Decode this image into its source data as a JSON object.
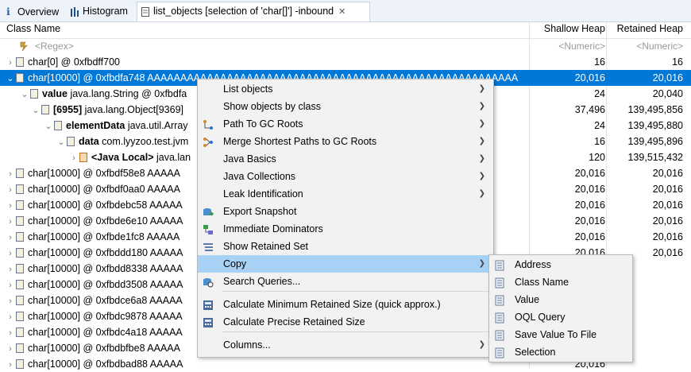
{
  "tabs": [
    {
      "label": "Overview"
    },
    {
      "label": "Histogram"
    },
    {
      "label": "list_objects  [selection of 'char[]'] -inbound"
    }
  ],
  "columns": {
    "class_name": "Class Name",
    "shallow_heap": "Shallow Heap",
    "retained_heap": "Retained Heap"
  },
  "filters": {
    "class_name": "<Regex>",
    "shallow_heap": "<Numeric>",
    "retained_heap": "<Numeric>"
  },
  "rows": [
    {
      "bold": "",
      "text": "char[0] @ 0xfbdff700",
      "extra": "",
      "shallow": "16",
      "retained": "16"
    },
    {
      "bold": "",
      "text": "char[10000] @ 0xfbdfa748  AAAAAAAAAAAAAAAAAAAAAAAAAAAAAAAAAAAAAAAAAAAAAAAAAAAAAAAA",
      "extra": "",
      "shallow": "20,016",
      "retained": "20,016"
    },
    {
      "bold": "value",
      "text": " java.lang.String @ 0xfbdfa",
      "extra": "AAAAA",
      "shallow": "24",
      "retained": "20,040"
    },
    {
      "bold": "[6955]",
      "text": " java.lang.Object[9369]",
      "extra": "",
      "shallow": "37,496",
      "retained": "139,495,856"
    },
    {
      "bold": "elementData",
      "text": " java.util.Array",
      "extra": "",
      "shallow": "24",
      "retained": "139,495,880"
    },
    {
      "bold": "data",
      "text": " com.lyyzoo.test.jvm",
      "extra": "",
      "shallow": "16",
      "retained": "139,495,896"
    },
    {
      "bold": "<Java Local>",
      "text": " java.lan",
      "extra": "",
      "shallow": "120",
      "retained": "139,515,432"
    },
    {
      "bold": "",
      "text": "char[10000] @ 0xfbdf58e8  AAAAA",
      "extra": "AAAAA",
      "shallow": "20,016",
      "retained": "20,016"
    },
    {
      "bold": "",
      "text": "char[10000] @ 0xfbdf0aa0  AAAAA",
      "extra": "AAAAA",
      "shallow": "20,016",
      "retained": "20,016"
    },
    {
      "bold": "",
      "text": "char[10000] @ 0xfbdebc58  AAAAA",
      "extra": "AAAAA",
      "shallow": "20,016",
      "retained": "20,016"
    },
    {
      "bold": "",
      "text": "char[10000] @ 0xfbde6e10  AAAAA",
      "extra": "AAAAA",
      "shallow": "20,016",
      "retained": "20,016"
    },
    {
      "bold": "",
      "text": "char[10000] @ 0xfbde1fc8  AAAAA",
      "extra": "AAAAA",
      "shallow": "20,016",
      "retained": "20,016"
    },
    {
      "bold": "",
      "text": "char[10000] @ 0xfbddd180  AAAAA",
      "extra": "AAAAA",
      "shallow": "20,016",
      "retained": "20,016"
    },
    {
      "bold": "",
      "text": "char[10000] @ 0xfbdd8338  AAAAA",
      "extra": "",
      "shallow": "",
      "retained": ""
    },
    {
      "bold": "",
      "text": "char[10000] @ 0xfbdd3508  AAAAA",
      "extra": "",
      "shallow": "",
      "retained": ""
    },
    {
      "bold": "",
      "text": "char[10000] @ 0xfbdce6a8  AAAAA",
      "extra": "",
      "shallow": "",
      "retained": ""
    },
    {
      "bold": "",
      "text": "char[10000] @ 0xfbdc9878  AAAAA",
      "extra": "",
      "shallow": "",
      "retained": ""
    },
    {
      "bold": "",
      "text": "char[10000] @ 0xfbdc4a18  AAAAA",
      "extra": "",
      "shallow": "",
      "retained": ""
    },
    {
      "bold": "",
      "text": "char[10000] @ 0xfbdbfbe8  AAAAA",
      "extra": "",
      "shallow": "",
      "retained": ""
    },
    {
      "bold": "",
      "text": "char[10000] @ 0xfbdbad88  AAAAA",
      "extra": "",
      "shallow": "20,016",
      "retained": ""
    }
  ],
  "context_menu": {
    "items": [
      {
        "label": "List objects",
        "submenu": true,
        "icon": ""
      },
      {
        "label": "Show objects by class",
        "submenu": true,
        "icon": ""
      },
      {
        "label": "Path To GC Roots",
        "submenu": true,
        "icon": "path-icon"
      },
      {
        "label": "Merge Shortest Paths to GC Roots",
        "submenu": true,
        "icon": "merge-icon"
      },
      {
        "label": "Java Basics",
        "submenu": true,
        "icon": ""
      },
      {
        "label": "Java Collections",
        "submenu": true,
        "icon": ""
      },
      {
        "label": "Leak Identification",
        "submenu": true,
        "icon": ""
      },
      {
        "label": "Export Snapshot",
        "submenu": false,
        "icon": "export-icon"
      },
      {
        "label": "Immediate Dominators",
        "submenu": false,
        "icon": "dominators-icon"
      },
      {
        "label": "Show Retained Set",
        "submenu": false,
        "icon": "retained-set-icon"
      },
      {
        "label": "Copy",
        "submenu": true,
        "icon": "",
        "highlighted": true
      },
      {
        "label": "Search Queries...",
        "submenu": false,
        "icon": "search-queries-icon"
      },
      {
        "label": "Calculate Minimum Retained Size (quick approx.)",
        "submenu": false,
        "icon": "calculator-icon"
      },
      {
        "label": "Calculate Precise Retained Size",
        "submenu": false,
        "icon": "calculator-icon"
      },
      {
        "label": "Columns...",
        "submenu": true,
        "icon": ""
      }
    ]
  },
  "copy_submenu": {
    "items": [
      {
        "label": "Address"
      },
      {
        "label": "Class Name"
      },
      {
        "label": "Value"
      },
      {
        "label": "OQL Query"
      },
      {
        "label": "Save Value To File"
      },
      {
        "label": "Selection"
      }
    ]
  }
}
